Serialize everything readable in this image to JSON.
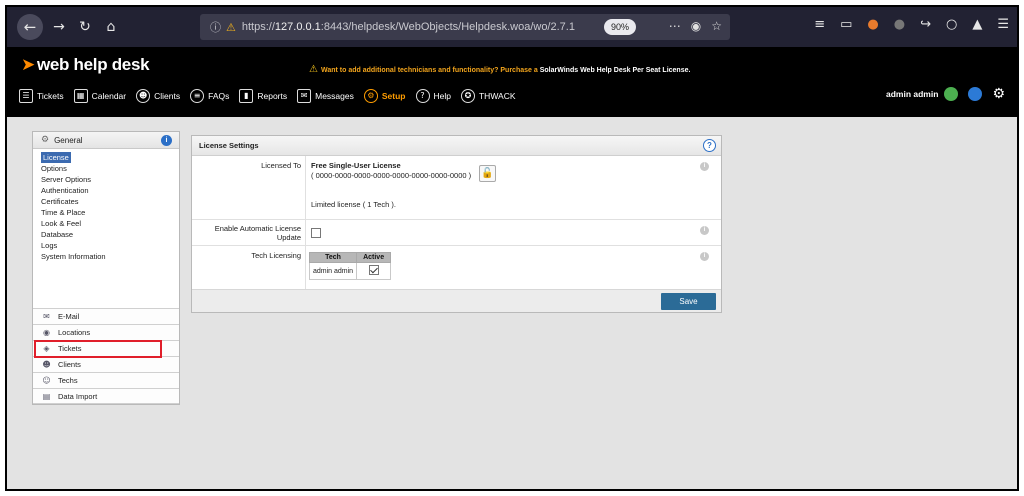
{
  "browser": {
    "back_icon": "arrow-left-icon",
    "url_prefix": "https://",
    "url_host": "127.0.0.1",
    "url_rest": ":8443/helpdesk/WebObjects/Helpdesk.woa/wo/2.7.1",
    "zoom": "90%"
  },
  "app": {
    "logo_text": "web help desk",
    "promo_text": "Want to add additional technicians and functionality? Purchase a ",
    "promo_strong": "SolarWinds Web Help Desk Per Seat License.",
    "nav": [
      {
        "label": "Tickets",
        "icon": "list-icon"
      },
      {
        "label": "Calendar",
        "icon": "calendar-icon"
      },
      {
        "label": "Clients",
        "icon": "client-icon"
      },
      {
        "label": "FAQs",
        "icon": "faq-icon"
      },
      {
        "label": "Reports",
        "icon": "report-icon"
      },
      {
        "label": "Messages",
        "icon": "envelope-icon"
      },
      {
        "label": "Setup",
        "icon": "setup-gear-icon"
      },
      {
        "label": "Help",
        "icon": "help-icon"
      },
      {
        "label": "THWACK",
        "icon": "thwack-icon"
      }
    ],
    "user_name": "admin admin"
  },
  "sidebar": {
    "general_label": "General",
    "general_links": [
      "License",
      "Options",
      "Server Options",
      "Authentication",
      "Certificates",
      "Time & Place",
      "Look & Feel",
      "Database",
      "Logs",
      "System Information"
    ],
    "sections": [
      {
        "label": "E-Mail",
        "icon": "mail-icon"
      },
      {
        "label": "Locations",
        "icon": "location-pin-icon"
      },
      {
        "label": "Tickets",
        "icon": "ticket-icon"
      },
      {
        "label": "Clients",
        "icon": "clients-icon"
      },
      {
        "label": "Techs",
        "icon": "tech-icon"
      },
      {
        "label": "Data Import",
        "icon": "data-import-icon"
      }
    ]
  },
  "license": {
    "panel_title": "License Settings",
    "licensed_to_label": "Licensed To",
    "license_name": "Free Single-User License",
    "license_key": "( 0000-0000-0000-0000-0000-0000-0000-0000 )",
    "license_limit": "Limited license ( 1 Tech ).",
    "auto_update_label": "Enable Automatic License Update",
    "tech_licensing_label": "Tech Licensing",
    "table_headers": [
      "Tech",
      "Active"
    ],
    "table_rows": [
      {
        "tech": "admin admin",
        "active": true
      }
    ],
    "save_label": "Save"
  }
}
